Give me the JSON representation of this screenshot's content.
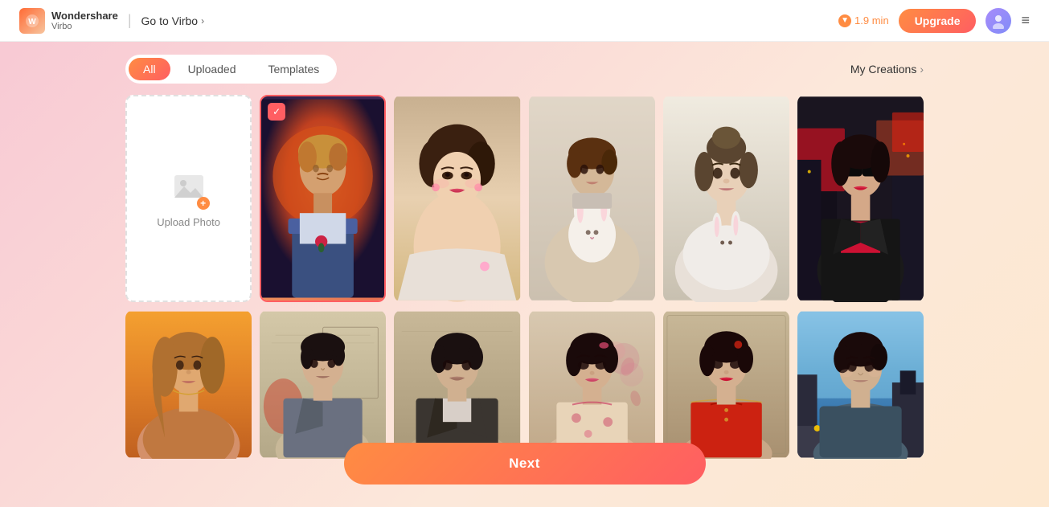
{
  "header": {
    "logo_text": "Wondershare",
    "logo_sub": "Virbo",
    "goto_virbo": "Go to Virbo",
    "time": "1.9 min",
    "upgrade_label": "Upgrade",
    "menu_icon": "≡"
  },
  "filters": {
    "tabs": [
      {
        "id": "all",
        "label": "All",
        "active": true
      },
      {
        "id": "uploaded",
        "label": "Uploaded",
        "active": false
      },
      {
        "id": "templates",
        "label": "Templates",
        "active": false
      }
    ],
    "my_creations": "My Creations"
  },
  "upload_card": {
    "label": "Upload Photo"
  },
  "next_button": {
    "label": "Next"
  },
  "images": {
    "row1": [
      {
        "id": "img-selected",
        "selected": true,
        "alt": "Artistic male portrait with rose",
        "color_class": "img-1"
      },
      {
        "id": "img-vintage-woman",
        "selected": false,
        "alt": "Vintage style woman portrait",
        "color_class": "img-2"
      },
      {
        "id": "img-youth-rabbit",
        "selected": false,
        "alt": "Youth with rabbit portrait",
        "color_class": "img-3"
      },
      {
        "id": "img-woman-rabbit",
        "selected": false,
        "alt": "Woman with rabbit portrait",
        "color_class": "img-4"
      },
      {
        "id": "img-city-woman",
        "selected": false,
        "alt": "Woman in city with leather jacket",
        "color_class": "img-5"
      }
    ],
    "row2": [
      {
        "id": "img-golden-woman",
        "selected": false,
        "alt": "Golden hour woman portrait",
        "color_class": "img-6"
      },
      {
        "id": "img-sketch-man",
        "selected": false,
        "alt": "Sketch style Asian man portrait",
        "color_class": "img-7"
      },
      {
        "id": "img-sketch-man2",
        "selected": false,
        "alt": "Sketch style man portrait 2",
        "color_class": "img-8"
      },
      {
        "id": "img-sketch-woman",
        "selected": false,
        "alt": "Sketch style Asian woman portrait",
        "color_class": "img-9"
      },
      {
        "id": "img-sketch-woman2",
        "selected": false,
        "alt": "Sketch style woman portrait 2",
        "color_class": "img-10"
      },
      {
        "id": "img-city-man",
        "selected": false,
        "alt": "Young man city background",
        "color_class": "img-11"
      }
    ]
  }
}
